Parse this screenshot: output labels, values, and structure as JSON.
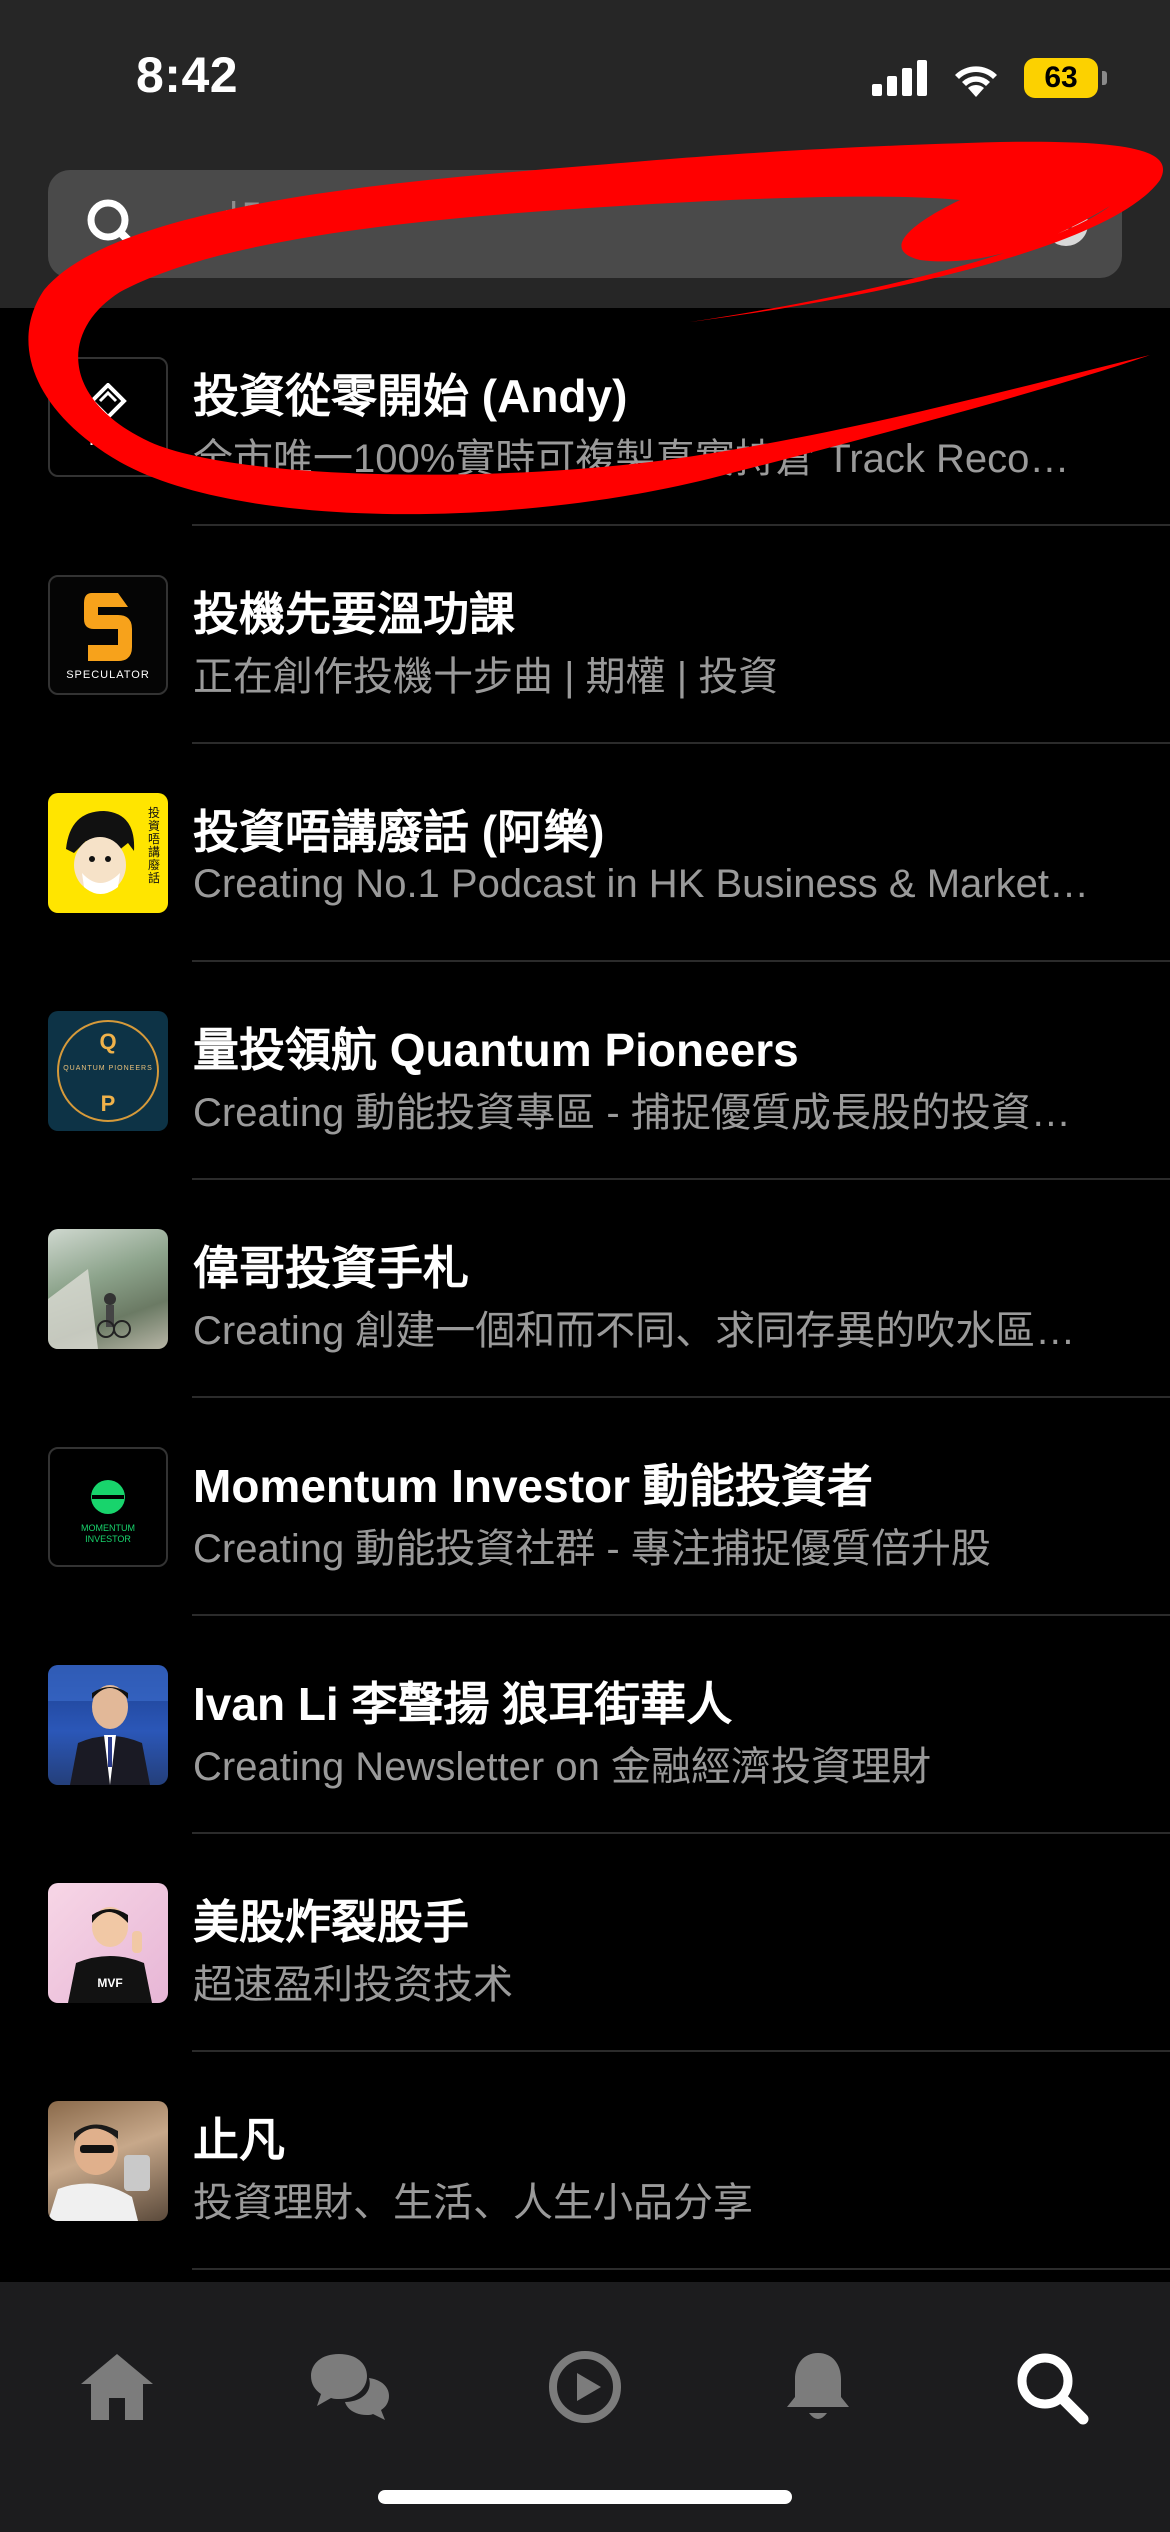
{
  "status_bar": {
    "time": "8:42",
    "battery": "63"
  },
  "search": {
    "query": "投"
  },
  "results": [
    {
      "title": "投資從零開始 (Andy)",
      "subtitle": "全市唯一100%實時可複製真實持倉 Track Reco…",
      "avatar_text": "IFZ"
    },
    {
      "title": "投機先要溫功課",
      "subtitle": "正在創作投機十步曲 | 期權 | 投資",
      "avatar_text": "SPECULATOR"
    },
    {
      "title": "投資唔講廢話 (阿樂)",
      "subtitle": "Creating No.1 Podcast in HK Business & Market…",
      "avatar_text": "投資唔講廢話"
    },
    {
      "title": "量投領航 Quantum Pioneers",
      "subtitle": "Creating 動能投資專區 - 捕捉優質成長股的投資…",
      "avatar_text": "QUANTUM PIONEERS"
    },
    {
      "title": "偉哥投資手札",
      "subtitle": "Creating 創建一個和而不同、求同存異的吹水區…"
    },
    {
      "title": "Momentum Investor 動能投資者",
      "subtitle": "Creating 動能投資社群 - 專注捕捉優質倍升股",
      "avatar_text": "MOMENTUM INVESTOR"
    },
    {
      "title": "Ivan Li 李聲揚  狼耳街華人",
      "subtitle": "Creating Newsletter on 金融經濟投資理財"
    },
    {
      "title": "美股炸裂股手",
      "subtitle": "超速盈利投资技术"
    },
    {
      "title": "止凡",
      "subtitle": "投資理財、生活、人生小品分享"
    }
  ],
  "colors": {
    "background": "#000000",
    "header": "#262626",
    "annotation": "#ff0000",
    "battery": "#fcd100"
  },
  "tabbar": {
    "tabs": [
      "home-icon",
      "chat-icon",
      "play-icon",
      "bell-icon",
      "search-icon"
    ],
    "active": "search-icon"
  }
}
